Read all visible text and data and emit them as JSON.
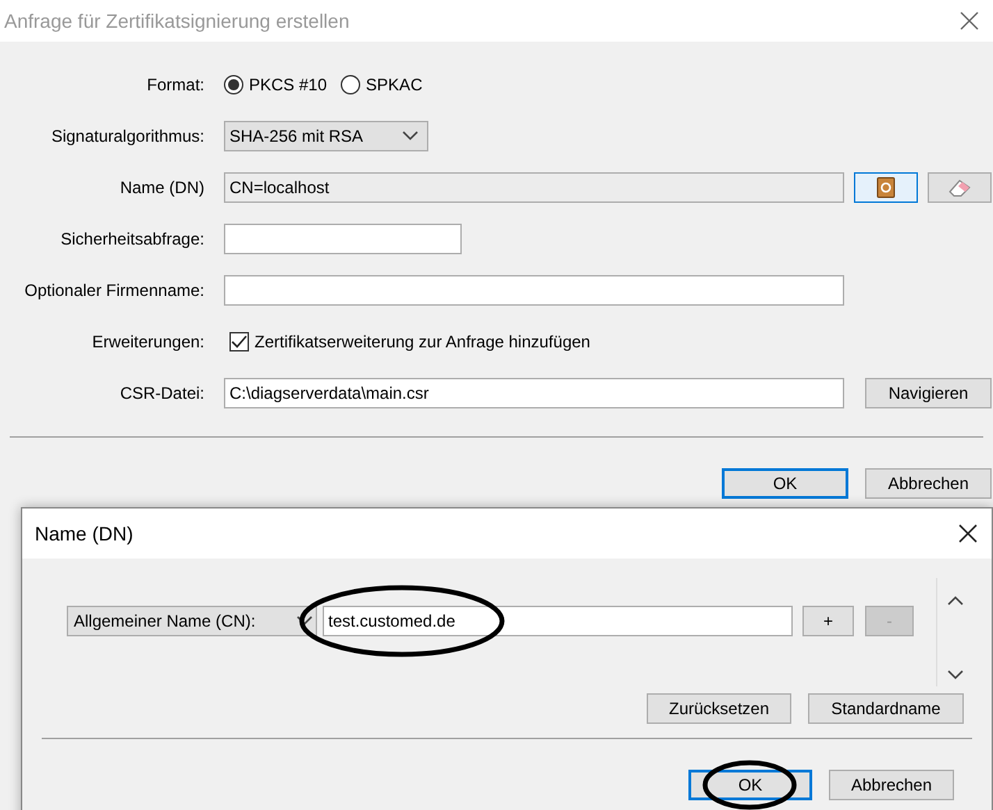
{
  "window": {
    "title": "Anfrage für Zertifikatsignierung erstellen"
  },
  "rows": [
    {
      "kind": "radio",
      "label": "Format:",
      "options": [
        {
          "label": "PKCS #10",
          "selected": true
        },
        {
          "label": "SPKAC",
          "selected": false
        }
      ]
    },
    {
      "kind": "select",
      "label": "Signaturalgorithmus:",
      "value": "SHA-256 mit RSA"
    },
    {
      "kind": "name",
      "label": "Name (DN)",
      "value": "CN=localhost"
    },
    {
      "kind": "short",
      "label": "Sicherheitsabfrage:"
    },
    {
      "kind": "text",
      "label": "Optionaler Firmenname:"
    },
    {
      "kind": "checkbox",
      "label": "Erweiterungen:",
      "text": "Zertifikatserweiterung zur Anfrage hinzufügen",
      "checked": true
    },
    {
      "kind": "file",
      "label": "CSR-Datei:",
      "value": "C:\\diagserverdata\\main.csr",
      "button": "Navigieren"
    }
  ],
  "buttons": [
    {
      "label": "OK",
      "default": true
    },
    {
      "label": "Abbrechen",
      "default": false
    }
  ],
  "dialog": {
    "title": "Name (DN)",
    "entries": [
      {
        "attribute": "Allgemeiner Name (CN):",
        "value": "test.customed.de",
        "add": "+",
        "remove": "-",
        "remove_disabled": true,
        "circled": true
      }
    ],
    "actions": [
      "Zurücksetzen",
      "Standardname"
    ],
    "buttons": [
      {
        "label": "OK",
        "default": true,
        "circled": true
      },
      {
        "label": "Abbrechen",
        "default": false,
        "circled": false
      }
    ]
  }
}
